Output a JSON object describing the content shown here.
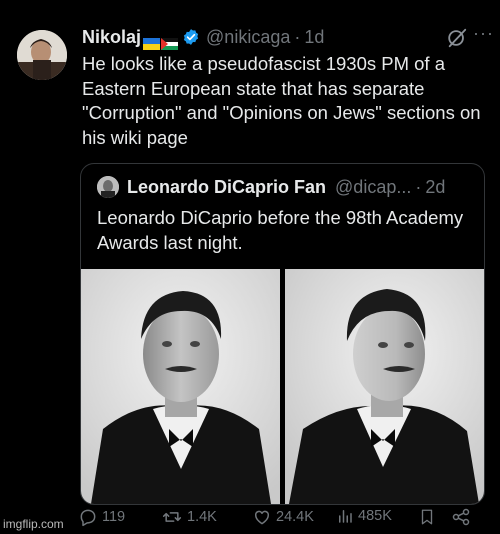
{
  "tweet": {
    "display_name": "Nikolaj",
    "handle": "@nikicaga",
    "separator": "·",
    "time": "1d",
    "text": "He looks like a pseudofascist 1930s PM of a Eastern European state that has separate \"Corruption\" and \"Opinions on Jews\" sections on his wiki page",
    "flags": [
      "ukraine-flag",
      "palestine-flag"
    ]
  },
  "quote": {
    "display_name": "Leonardo DiCaprio Fan",
    "handle": "@dicap...",
    "separator": "·",
    "time": "2d",
    "text": "Leonardo DiCaprio before the 98th Academy Awards last night."
  },
  "actions": {
    "replies": "119",
    "reposts": "1.4K",
    "likes": "24.4K",
    "views": "485K"
  },
  "watermark": "imgflip.com",
  "colors": {
    "background": "#000000",
    "text": "#e7e9ea",
    "muted": "#71767b",
    "verified": "#1d9bf0",
    "border": "#333639"
  },
  "icons": [
    "grok-icon",
    "more-icon",
    "verified-icon",
    "reply-icon",
    "repost-icon",
    "like-icon",
    "views-icon",
    "bookmark-icon",
    "share-icon"
  ]
}
